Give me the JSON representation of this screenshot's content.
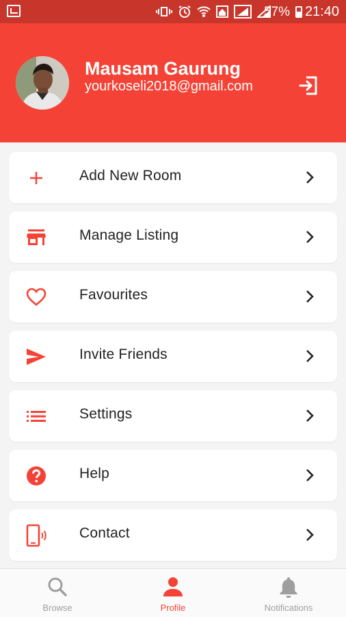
{
  "colors": {
    "accent": "#f44336",
    "statusbar": "#c8352b"
  },
  "status_bar": {
    "battery": "57%",
    "time": "21:40"
  },
  "header": {
    "name": "Mausam Gaurung",
    "email": "yourkoseli2018@gmail.com",
    "logout_icon": "logout-icon"
  },
  "menu": {
    "items": [
      {
        "label": "Add New Room",
        "icon": "plus-icon"
      },
      {
        "label": "Manage Listing",
        "icon": "store-icon"
      },
      {
        "label": "Favourites",
        "icon": "heart-icon"
      },
      {
        "label": "Invite Friends",
        "icon": "send-icon"
      },
      {
        "label": "Settings",
        "icon": "list-icon"
      },
      {
        "label": "Help",
        "icon": "help-icon"
      },
      {
        "label": "Contact",
        "icon": "phone-ring-icon"
      }
    ]
  },
  "bottom_nav": {
    "items": [
      {
        "label": "Browse",
        "icon": "search-icon"
      },
      {
        "label": "Profile",
        "icon": "person-icon",
        "active": true
      },
      {
        "label": "Notifications",
        "icon": "bell-icon"
      }
    ]
  }
}
